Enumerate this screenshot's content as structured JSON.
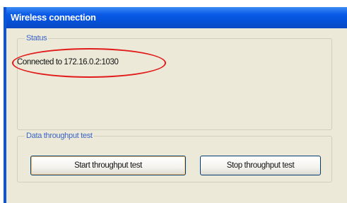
{
  "window": {
    "title": "Wireless connection"
  },
  "status_group": {
    "legend": "Status",
    "text": "Connected to 172.16.0.2:1030"
  },
  "throughput_group": {
    "legend": "Data throughput test",
    "start_button_label": "Start throughput test",
    "stop_button_label": "Stop throughput test"
  },
  "colors": {
    "title_bar": "#0a5ae8",
    "window_bg": "#ece9d8",
    "legend_text": "#3c64c8",
    "annotation_ellipse": "#e21a1a"
  }
}
